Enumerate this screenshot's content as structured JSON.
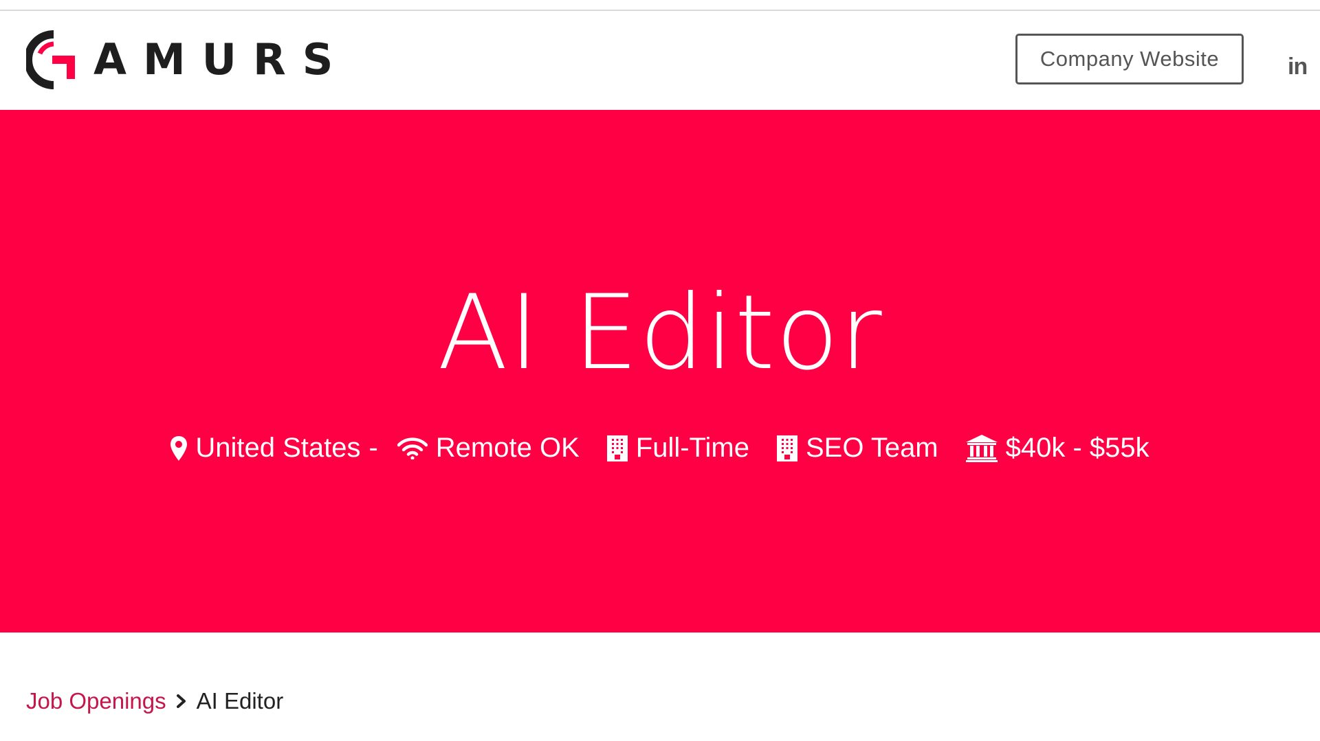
{
  "header": {
    "logo_text": "AMURS",
    "logo_alt": "GAMURS",
    "company_website_label": "Company Website",
    "linkedin_label": "in"
  },
  "hero": {
    "title": "AI Editor",
    "meta": {
      "location": "United States",
      "location_separator": "-",
      "remote": "Remote OK",
      "employment_type": "Full-Time",
      "team": "SEO Team",
      "salary": "$40k - $55k"
    }
  },
  "breadcrumb": {
    "parent": "Job Openings",
    "current": "AI Editor"
  },
  "colors": {
    "brand_red": "#ff0045",
    "link_red": "#c4164a",
    "logo_dark": "#1e1e1e"
  }
}
